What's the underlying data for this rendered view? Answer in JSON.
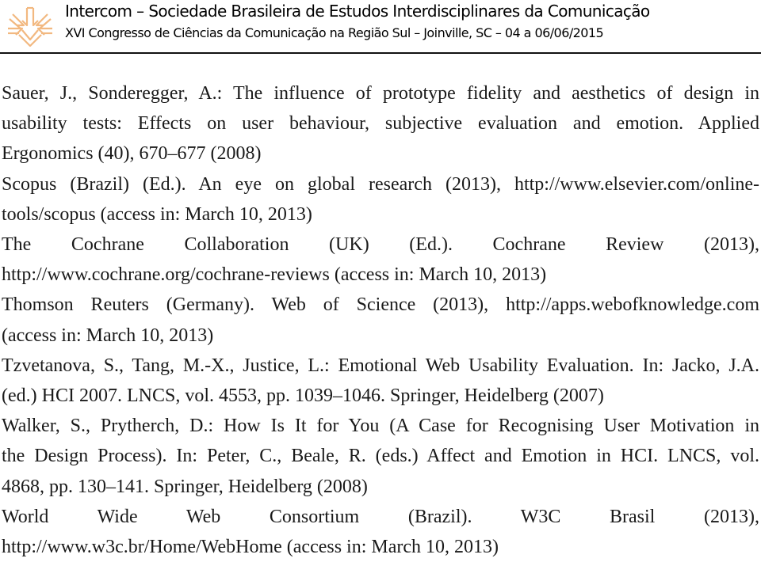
{
  "header": {
    "logo": "intercom-logo-icon",
    "title": "Intercom – Sociedade Brasileira de Estudos Interdisciplinares da Comunicação",
    "subtitle": "XVI Congresso de Ciências da Comunicação na Região Sul – Joinville, SC – 04 a 06/06/2015",
    "logo_color": "#f2b880"
  },
  "references": [
    {
      "lines": [
        "Sauer, J., Sonderegger, A.: The influence of prototype fidelity and aesthetics of design in",
        "usability tests: Effects on user behaviour, subjective evaluation and emotion. Applied",
        "Ergonomics (40), 670–677 (2008)"
      ]
    },
    {
      "lines": [
        "Scopus (Brazil) (Ed.). An eye on global research (2013), http://www.elsevier.com/online-",
        "tools/scopus (access in: March 10, 2013)"
      ]
    },
    {
      "lines": [
        "The Cochrane Collaboration (UK) (Ed.). Cochrane Review (2013),",
        "http://www.cochrane.org/cochrane-reviews (access in: March 10, 2013)"
      ]
    },
    {
      "lines": [
        "Thomson Reuters (Germany). Web of Science (2013), http://apps.webofknowledge.com",
        "(access in: March 10, 2013)"
      ]
    },
    {
      "lines": [
        "Tzvetanova, S., Tang, M.-X., Justice, L.: Emotional Web Usability Evaluation. In: Jacko, J.A.",
        "(ed.) HCI 2007. LNCS, vol. 4553, pp. 1039–1046. Springer, Heidelberg (2007)"
      ]
    },
    {
      "lines": [
        "Walker, S., Prytherch, D.: How Is It for You (A Case for Recognising User Motivation in",
        "the Design Process). In: Peter, C., Beale, R. (eds.) Affect and Emotion in HCI. LNCS, vol.",
        "4868, pp. 130–141. Springer, Heidelberg (2008)"
      ]
    },
    {
      "lines": [
        "World Wide Web Consortium (Brazil). W3C Brasil (2013),",
        "http://www.w3c.br/Home/WebHome (access in: March 10, 2013)"
      ]
    }
  ]
}
